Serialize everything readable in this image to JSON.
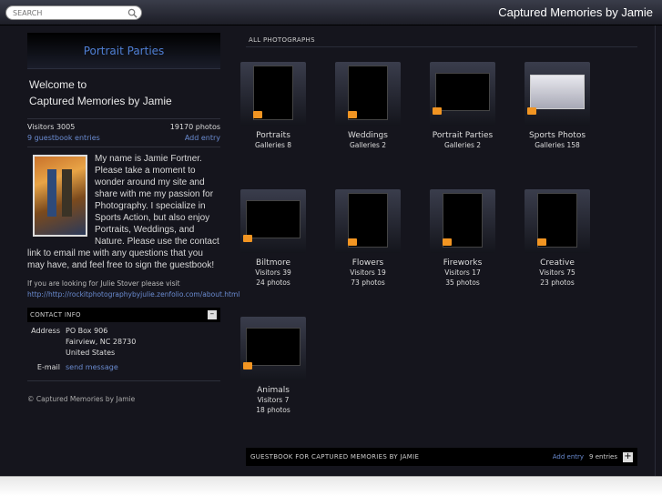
{
  "header": {
    "search_placeholder": "SEARCH",
    "site_title": "Captured Memories by Jamie"
  },
  "sidebar": {
    "category_title": "Portrait Parties",
    "welcome_line1": "Welcome to",
    "welcome_line2": "Captured Memories by Jamie",
    "visitors": "Visitors 3005",
    "photos": "19170 photos",
    "guestbook_entries": "9 guestbook entries",
    "add_entry": "Add entry",
    "bio": "My name is Jamie Fortner. Please take a moment to wonder around my site and share with me my passion for Photography. I specialize in Sports Action, but also enjoy Portraits, Weddings, and Nature. Please use the contact link to email me with any questions that you may have, and feel free to sign the guestbook!",
    "julie_text": "If you are looking for Julie Stover please visit",
    "julie_link": "http://http://rockitphotographybyjulie.zenfolio.com/about.html",
    "contact_heading": "CONTACT INFO",
    "contact_toggle": "–",
    "address_label": "Address",
    "address_line1": "PO Box 906",
    "address_line2": "Fairview, NC 28730",
    "address_line3": "United States",
    "email_label": "E-mail",
    "email_link": "send message",
    "copyright": "© Captured Memories by Jamie"
  },
  "main": {
    "heading": "ALL PHOTOGRAPHS",
    "tiles": [
      {
        "name": "Portraits",
        "meta1": "Galleries 8",
        "meta2": ""
      },
      {
        "name": "Weddings",
        "meta1": "Galleries 2",
        "meta2": ""
      },
      {
        "name": "Portrait Parties",
        "meta1": "Galleries 2",
        "meta2": ""
      },
      {
        "name": "Sports Photos",
        "meta1": "Galleries 158",
        "meta2": ""
      },
      {
        "name": "Biltmore",
        "meta1": "Visitors 39",
        "meta2": "24 photos"
      },
      {
        "name": "Flowers",
        "meta1": "Visitors 19",
        "meta2": "73 photos"
      },
      {
        "name": "Fireworks",
        "meta1": "Visitors 17",
        "meta2": "35 photos"
      },
      {
        "name": "Creative",
        "meta1": "Visitors 75",
        "meta2": "23 photos"
      },
      {
        "name": "Animals",
        "meta1": "Visitors 7",
        "meta2": "18 photos"
      }
    ]
  },
  "guestbook": {
    "heading": "GUESTBOOK FOR CAPTURED MEMORIES BY JAMIE",
    "add_entry": "Add entry",
    "entries": "9 entries",
    "plus": "+"
  },
  "colors": {
    "accent_link": "#6a8bd0",
    "folder_icon": "#f29522",
    "background": "#15151d"
  }
}
